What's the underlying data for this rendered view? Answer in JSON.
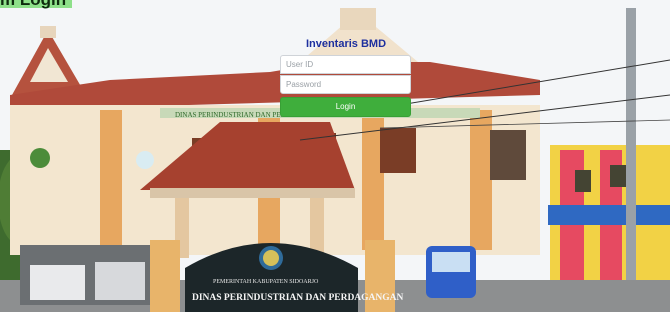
{
  "caption": "m Login",
  "login": {
    "title": "Inventaris BMD",
    "user_id_placeholder": "User ID",
    "password_placeholder": "Password",
    "button_label": "Login"
  },
  "building": {
    "banner_text": "DINAS PERINDUSTRIAN DAN PERDAGANGAN",
    "sign_small_text": "PEMERINTAH KABUPATEN SIDOARJO",
    "sign_large_text": "DINAS PERINDUSTRIAN DAN PERDAGANGAN"
  },
  "colors": {
    "title_blue": "#1d2f9e",
    "button_green": "#3fae3c",
    "caption_green": "#8ee08a"
  }
}
